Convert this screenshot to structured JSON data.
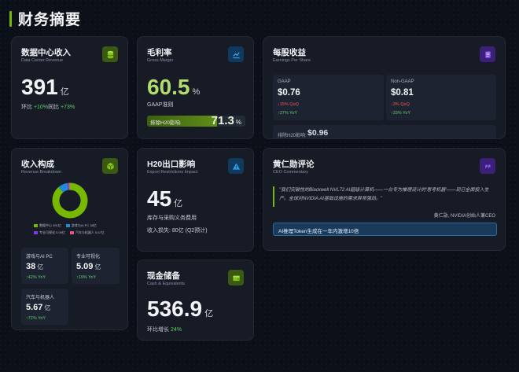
{
  "page": {
    "title": "财务摘要"
  },
  "colors": {
    "accent": "#76b900",
    "green": "#5fd068",
    "red": "#ef5a5a",
    "blue": "#1f8ad6",
    "purple": "#7b3fe4"
  },
  "datacenter": {
    "title": "数据中心收入",
    "subtitle": "Data Center Revenue",
    "icon": "database-icon",
    "value": "391",
    "unit": "亿",
    "qoq_label": "环比",
    "qoq_value": "+10%",
    "yoy_label": "同比",
    "yoy_value": "+73%"
  },
  "gross_margin": {
    "title": "毛利率",
    "subtitle": "Gross Margin",
    "icon": "chart-line-icon",
    "value": "60.5",
    "unit": "%",
    "basis": "GAAP准则",
    "excl_label": "排除H20影响:",
    "excl_value": "71.3",
    "excl_unit": "%",
    "excl_fill_percent": 71.3
  },
  "eps": {
    "title": "每股收益",
    "subtitle": "Earnings Per Share",
    "icon": "document-icon",
    "gaap": {
      "label": "GAAP",
      "value": "$0.76",
      "qoq": "↓15% QoQ",
      "yoy": "↑27% YoY"
    },
    "nongaap": {
      "label": "Non-GAAP",
      "value": "$0.81",
      "qoq": "↓3% QoQ",
      "yoy": "↑33% YoY"
    },
    "excl_label": "排除H20影响:",
    "excl_value": "$0.96"
  },
  "revenue_breakdown": {
    "title": "收入构成",
    "subtitle": "Revenue Breakdown",
    "icon": "cube-icon",
    "legend": [
      {
        "label": "数据中心 391亿",
        "color": "#76b900"
      },
      {
        "label": "游戏与AI PC 38亿",
        "color": "#1f8ad6"
      },
      {
        "label": "专业可视化 5.09亿",
        "color": "#7b3fe4"
      },
      {
        "label": "汽车与机器人 5.67亿",
        "color": "#e05a7a"
      }
    ],
    "items": [
      {
        "label": "游戏与AI PC",
        "value": "38",
        "unit": "亿",
        "yoy": "↑42% YoY"
      },
      {
        "label": "专业可视化",
        "value": "5.09",
        "unit": "亿",
        "yoy": "↑19% YoY"
      },
      {
        "label": "汽车与机器人",
        "value": "5.67",
        "unit": "亿",
        "yoy": "↑72% YoY"
      }
    ]
  },
  "chart_data": {
    "type": "pie",
    "categories": [
      "数据中心 391亿",
      "游戏与AI PC 38亿",
      "专业可视化 5.09亿",
      "汽车与机器人 5.67亿"
    ],
    "values": [
      391,
      38,
      5.09,
      5.67
    ],
    "colors": [
      "#76b900",
      "#1f8ad6",
      "#7b3fe4",
      "#e05a7a"
    ],
    "legend_position": "bottom"
  },
  "h20": {
    "title": "H20出口影响",
    "subtitle": "Export Restrictions Impact",
    "icon": "warning-icon",
    "value": "45",
    "unit": "亿",
    "desc": "库存与采购义务费用",
    "loss": "收入损失: 80亿 (Q2预计)"
  },
  "cash": {
    "title": "现金储备",
    "subtitle": "Cash & Equivalents",
    "icon": "wallet-icon",
    "value": "536.9",
    "unit": "亿",
    "growth_label": "环比增长",
    "growth_value": "24%"
  },
  "ceo": {
    "title": "黄仁勋评论",
    "subtitle": "CEO Commentary",
    "icon": "quote-icon",
    "quote": "\"我们突破性的Blackwell NVL72 AI超级计算机——一台专为推理设计的'思考机器'——现已全面投入生产。全球对NVIDIA AI基础设施的需求异常强劲。\"",
    "author": "黄仁勋, NVIDIA创始人兼CEO",
    "highlight": "AI推理Token生成在一年内激增10倍"
  }
}
